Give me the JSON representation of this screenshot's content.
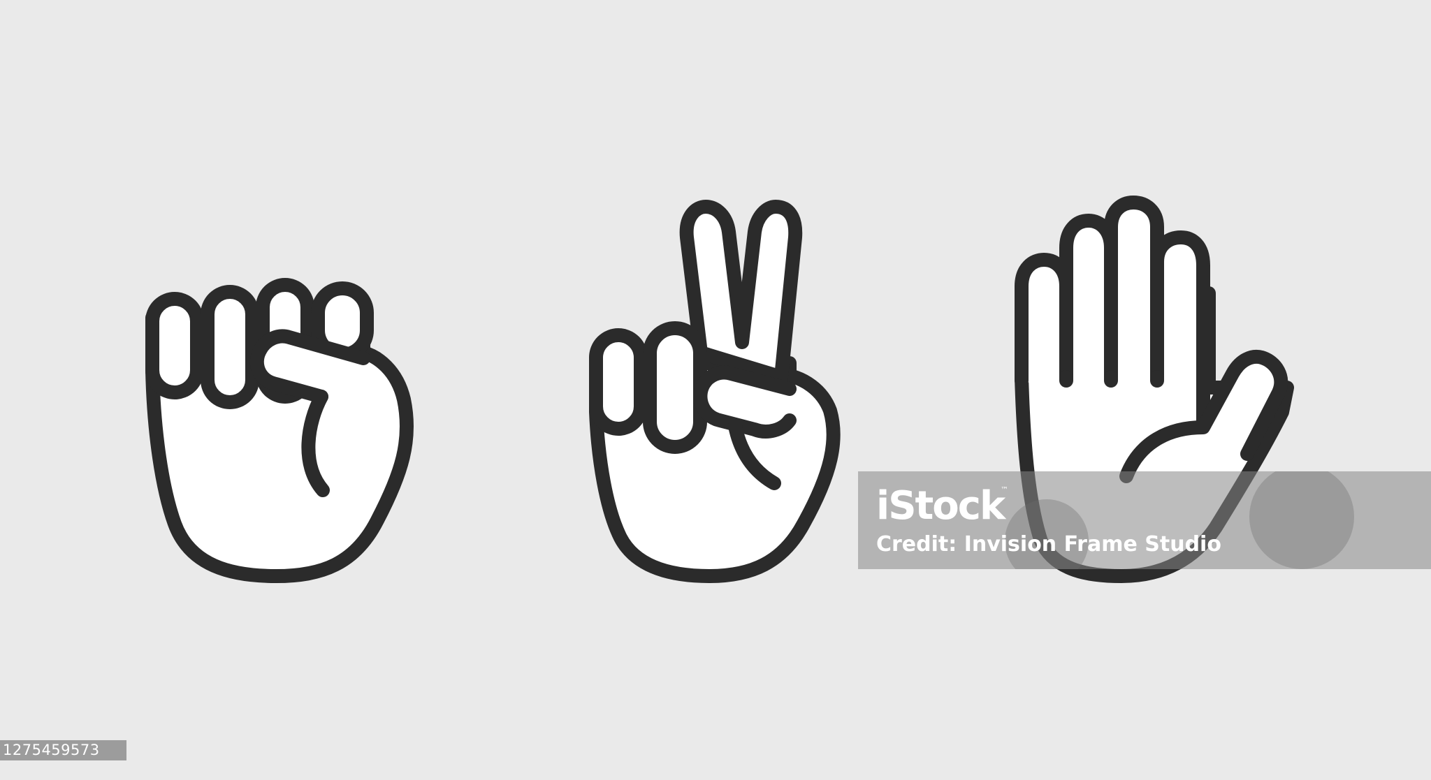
{
  "illustration": {
    "icons": [
      {
        "name": "fist-rock-icon"
      },
      {
        "name": "victory-scissors-icon"
      },
      {
        "name": "open-palm-paper-icon"
      }
    ],
    "stroke_color": "#2b2b2b",
    "background_color": "#eaeaea"
  },
  "watermark": {
    "logo": "iStock",
    "trademark": "™",
    "credit": "Credit: Invision Frame Studio"
  },
  "image_id": "1275459573"
}
